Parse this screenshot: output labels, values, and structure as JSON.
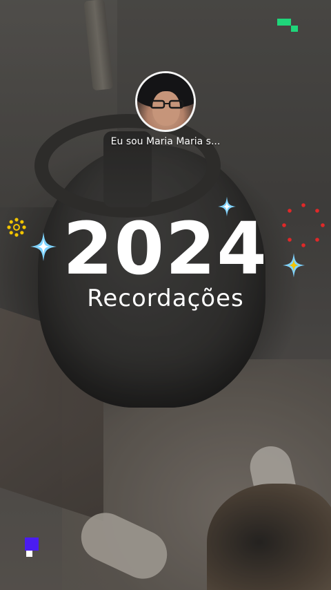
{
  "profile": {
    "username": "Eu sou Maria Maria s..."
  },
  "recap": {
    "year": "2024",
    "subtitle": "Recordações"
  },
  "colors": {
    "text": "#ffffff",
    "accent_green": "#1fd67a",
    "accent_purple": "#4a1cf0",
    "accent_red": "#e02828",
    "accent_yellow": "#f2c400",
    "sparkle_blue": "#7fd3ff"
  },
  "decorations": {
    "top_right": "green-pixel-icon",
    "left": "yellow-ring-icon",
    "right": "red-dot-circle-icon",
    "bottom_left": "purple-pixel-icon",
    "sparkles": "sparkle-icon"
  }
}
